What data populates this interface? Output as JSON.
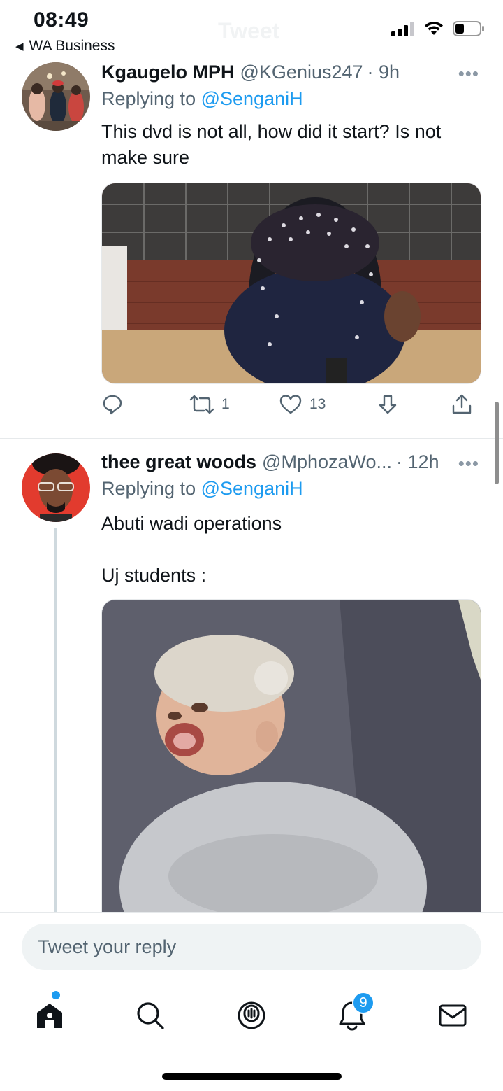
{
  "status_bar": {
    "time": "08:49",
    "back_app": "WA Business",
    "ghost_title": "Tweet",
    "icons": [
      "signal-icon",
      "wifi-icon",
      "battery-icon"
    ]
  },
  "tweets": [
    {
      "display_name": "Kgaugelo MPH",
      "handle": "@KGenius247",
      "time": "· 9h",
      "more": "•••",
      "replying_label": "Replying to",
      "replying_to": "@SenganiH",
      "text_lines": [
        "This dvd is not all, how did it start? Is not",
        "make sure"
      ],
      "actions": {
        "reply_count": "",
        "retweet_count": "1",
        "like_count": "13",
        "icons": [
          "reply-icon",
          "retweet-icon",
          "like-icon",
          "downvote-icon",
          "share-icon"
        ]
      }
    },
    {
      "display_name": "thee great woods",
      "handle": "@MphozaWo...",
      "time": "· 12h",
      "more": "•••",
      "replying_label": "Replying to",
      "replying_to": "@SenganiH",
      "text_line_1": "Abuti wadi operations",
      "text_line_2": "Uj students :"
    }
  ],
  "reply_bar": {
    "placeholder": "Tweet your reply"
  },
  "tab_bar": {
    "items": [
      "home-icon",
      "search-icon",
      "spaces-icon",
      "notifications-icon",
      "messages-icon"
    ],
    "notifications_badge": "9"
  },
  "colors": {
    "accent": "#1d9bf0",
    "secondary_text": "#536471",
    "primary_text": "#0f1419"
  }
}
